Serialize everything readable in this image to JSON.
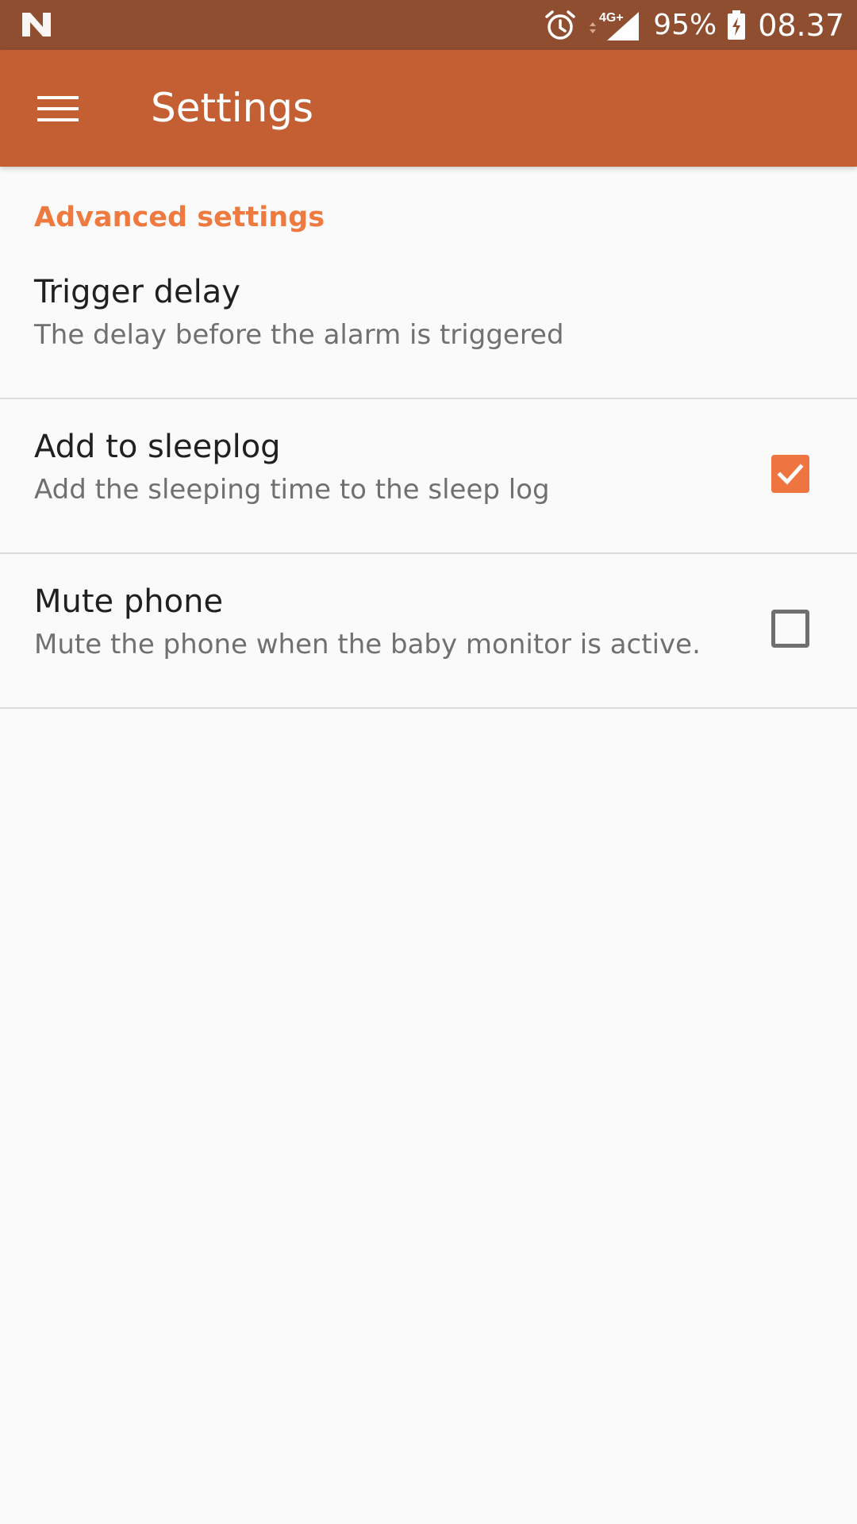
{
  "status_bar": {
    "icons": [
      "n-logo-icon",
      "alarm-icon",
      "network-4g-icon",
      "battery-charging-icon"
    ],
    "network_label": "4G+",
    "battery_percent": "95%",
    "time": "08.37"
  },
  "app_bar": {
    "title": "Settings",
    "menu_icon": "hamburger-menu-icon"
  },
  "colors": {
    "status_bar": "#8e4e2f",
    "app_bar": "#c45e33",
    "accent": "#ee7540",
    "background": "#fafafa"
  },
  "settings": {
    "section_title": "Advanced settings",
    "items": [
      {
        "title": "Trigger delay",
        "summary": "The delay before the alarm is triggered"
      },
      {
        "title": "Add to sleeplog",
        "summary": "Add the sleeping time to the sleep log",
        "checked": true
      },
      {
        "title": "Mute phone",
        "summary": "Mute the phone when the baby monitor is active.",
        "checked": false
      }
    ]
  }
}
